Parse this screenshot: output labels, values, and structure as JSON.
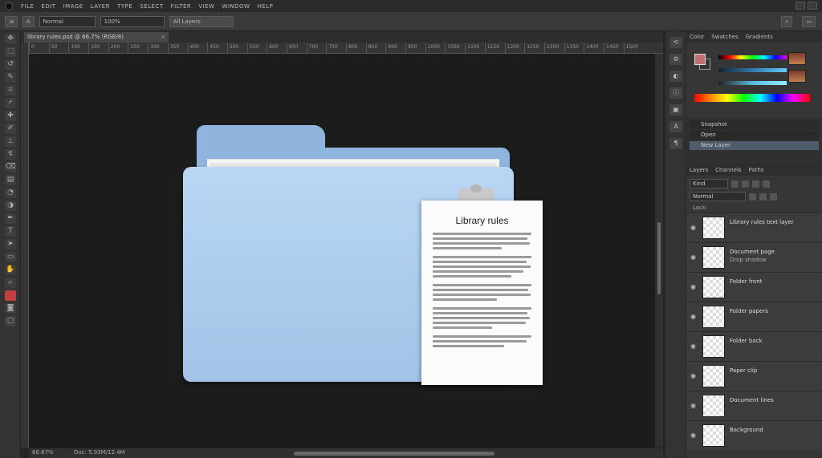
{
  "menu": [
    "FILE",
    "EDIT",
    "IMAGE",
    "LAYER",
    "TYPE",
    "SELECT",
    "FILTER",
    "VIEW",
    "WINDOW",
    "HELP"
  ],
  "options": {
    "tool_value": "A",
    "mode": "Normal",
    "opacity": "100%",
    "sample": "All Layers"
  },
  "document_tab": {
    "title": "library rules.psd @ 66.7% (RGB/8)",
    "close": "×"
  },
  "ruler_ticks": [
    "0",
    "50",
    "100",
    "150",
    "200",
    "250",
    "300",
    "350",
    "400",
    "450",
    "500",
    "550",
    "600",
    "650",
    "700",
    "750",
    "800",
    "850",
    "900",
    "950",
    "1000",
    "1050",
    "1100",
    "1150",
    "1200",
    "1250",
    "1300",
    "1350",
    "1400",
    "1450",
    "1500"
  ],
  "document": {
    "title": "Library rules"
  },
  "status": {
    "zoom": "66.67%",
    "info": "Doc: 5.93M/12.4M"
  },
  "panels": {
    "color_tabs": [
      "Color",
      "Swatches",
      "Gradients"
    ],
    "history_rows": [
      "Snapshot",
      "Open",
      "New Layer"
    ],
    "layers_tabs": [
      "Layers",
      "Channels",
      "Paths"
    ],
    "layers_kind": "Kind",
    "layers_mode": "Normal",
    "layers_header": "Lock:",
    "layers": [
      {
        "name": "Library rules text layer",
        "sub": ""
      },
      {
        "name": "Document page",
        "sub": "Drop shadow"
      },
      {
        "name": "Folder front",
        "sub": ""
      },
      {
        "name": "Folder papers",
        "sub": ""
      },
      {
        "name": "Folder back",
        "sub": ""
      },
      {
        "name": "Paper clip",
        "sub": ""
      },
      {
        "name": "Document lines",
        "sub": ""
      },
      {
        "name": "Background",
        "sub": ""
      }
    ]
  },
  "colors": {
    "folder": "#8fb5de",
    "folder_front": "#b9d6f3",
    "canvas": "#1c1c1c",
    "selected_row": "#4f5c6b"
  }
}
